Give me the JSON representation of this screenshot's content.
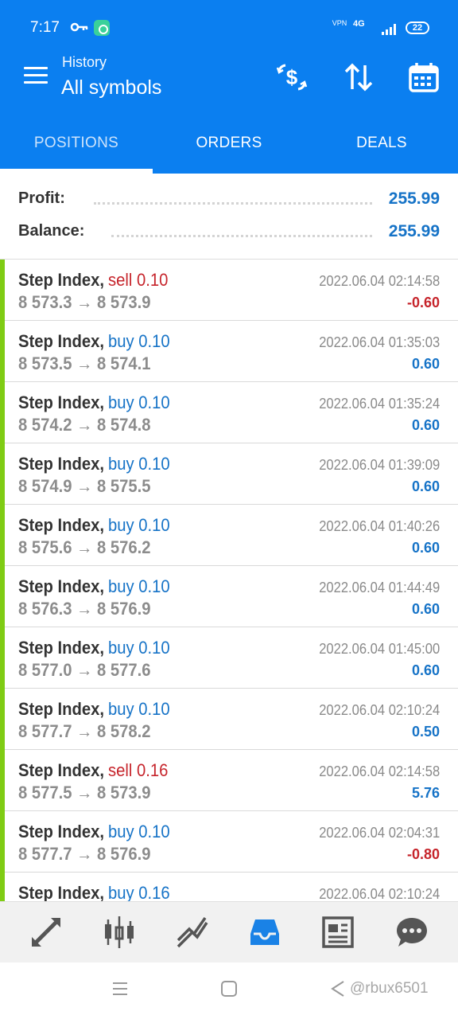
{
  "status_bar": {
    "time": "7:17",
    "vpn": "VPN",
    "network": "4G",
    "battery": "22"
  },
  "app_bar": {
    "subtitle": "History",
    "title": "All symbols",
    "icons": [
      "menu-icon",
      "currency-exchange-icon",
      "sort-icon",
      "calendar-icon"
    ]
  },
  "tabs": [
    {
      "label": "POSITIONS",
      "active": false
    },
    {
      "label": "ORDERS",
      "active": true
    },
    {
      "label": "DEALS",
      "active": false
    }
  ],
  "summary": {
    "profit_label": "Profit:",
    "profit_value": "255.99",
    "balance_label": "Balance:",
    "balance_value": "255.99"
  },
  "positions": [
    {
      "symbol": "Step Index,",
      "side": "sell",
      "volume": "sell 0.10",
      "prices": "8 573.3 → 8 573.9",
      "time": "2022.06.04 02:14:58",
      "profit": "-0.60"
    },
    {
      "symbol": "Step Index,",
      "side": "buy",
      "volume": "buy 0.10",
      "prices": "8 573.5 → 8 574.1",
      "time": "2022.06.04 01:35:03",
      "profit": "0.60"
    },
    {
      "symbol": "Step Index,",
      "side": "buy",
      "volume": "buy 0.10",
      "prices": "8 574.2 → 8 574.8",
      "time": "2022.06.04 01:35:24",
      "profit": "0.60"
    },
    {
      "symbol": "Step Index,",
      "side": "buy",
      "volume": "buy 0.10",
      "prices": "8 574.9 → 8 575.5",
      "time": "2022.06.04 01:39:09",
      "profit": "0.60"
    },
    {
      "symbol": "Step Index,",
      "side": "buy",
      "volume": "buy 0.10",
      "prices": "8 575.6 → 8 576.2",
      "time": "2022.06.04 01:40:26",
      "profit": "0.60"
    },
    {
      "symbol": "Step Index,",
      "side": "buy",
      "volume": "buy 0.10",
      "prices": "8 576.3 → 8 576.9",
      "time": "2022.06.04 01:44:49",
      "profit": "0.60"
    },
    {
      "symbol": "Step Index,",
      "side": "buy",
      "volume": "buy 0.10",
      "prices": "8 577.0 → 8 577.6",
      "time": "2022.06.04 01:45:00",
      "profit": "0.60"
    },
    {
      "symbol": "Step Index,",
      "side": "buy",
      "volume": "buy 0.10",
      "prices": "8 577.7 → 8 578.2",
      "time": "2022.06.04 02:10:24",
      "profit": "0.50"
    },
    {
      "symbol": "Step Index,",
      "side": "sell",
      "volume": "sell 0.16",
      "prices": "8 577.5 → 8 573.9",
      "time": "2022.06.04 02:14:58",
      "profit": "5.76"
    },
    {
      "symbol": "Step Index,",
      "side": "buy",
      "volume": "buy 0.10",
      "prices": "8 577.7 → 8 576.9",
      "time": "2022.06.04 02:04:31",
      "profit": "-0.80"
    },
    {
      "symbol": "Step Index,",
      "side": "buy",
      "volume": "buy 0.16",
      "prices": "",
      "time": "2022.06.04 02:10:24",
      "profit": ""
    }
  ],
  "bottom_nav": [
    "quotes-arrows-icon",
    "chart-candles-icon",
    "trade-chart-icon",
    "history-inbox-icon",
    "news-icon",
    "chat-icon"
  ],
  "watermark": "@rbux6501",
  "colors": {
    "brand": "#0b7ff0",
    "buy": "#1673c7",
    "sell": "#c6242b",
    "bar": "#7fcc14"
  }
}
